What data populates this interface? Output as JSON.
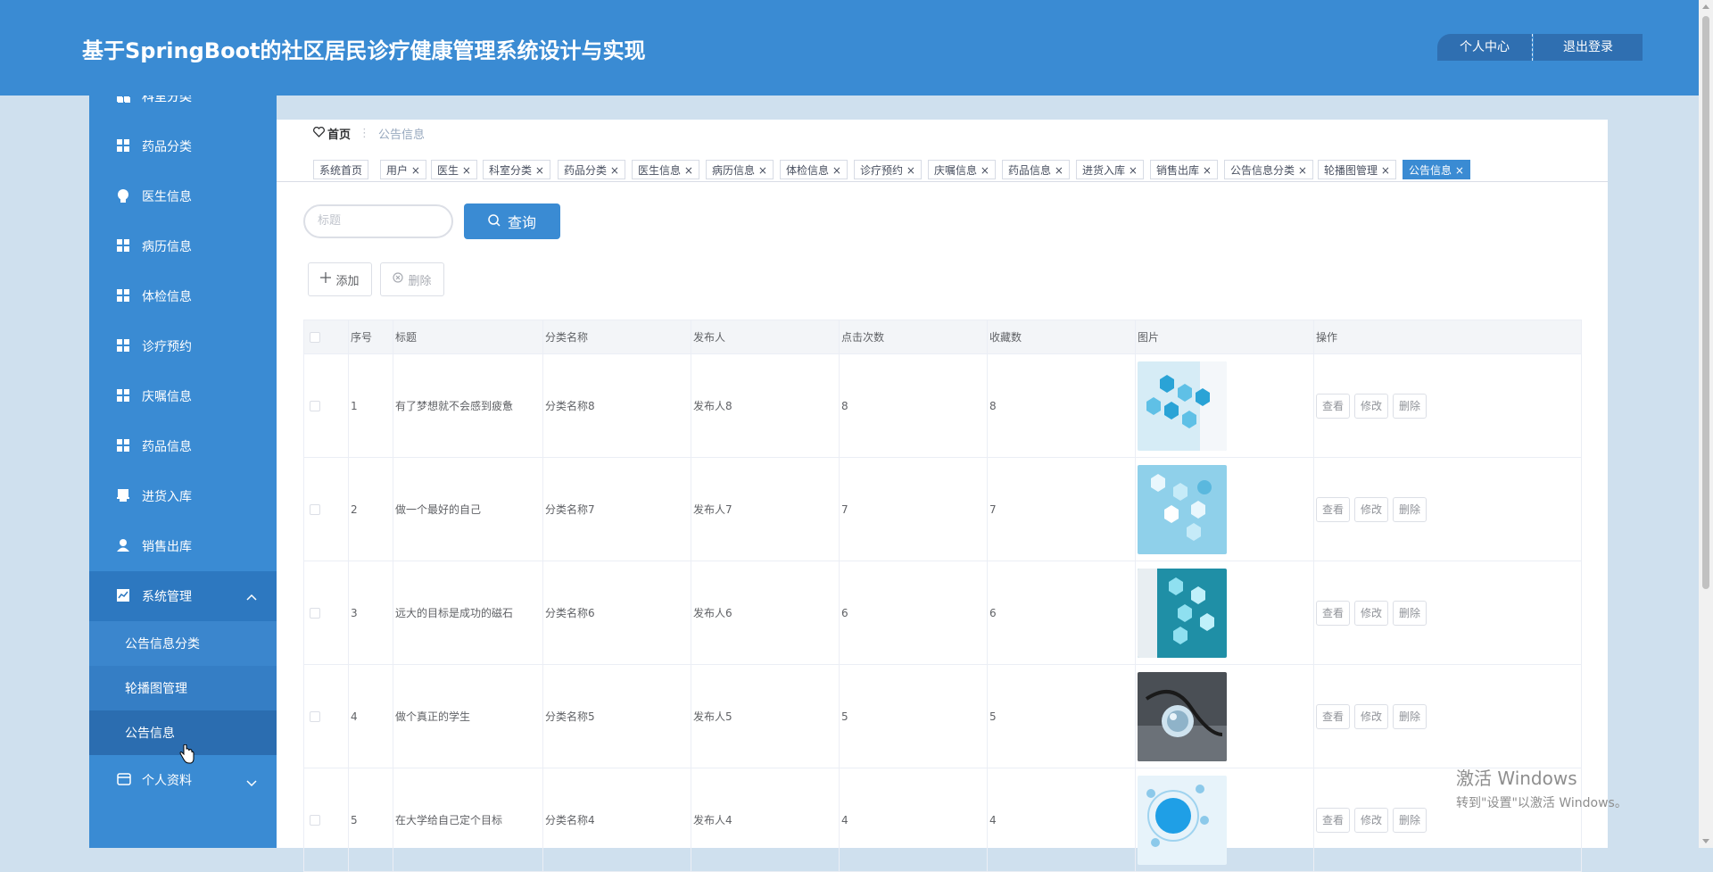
{
  "app": {
    "title": "基于SpringBoot的社区居民诊疗健康管理系统设计与实现",
    "user_center": "个人中心",
    "logout": "退出登录"
  },
  "sidebar": {
    "items": [
      {
        "label": "科室分类",
        "icon": "grid-icon"
      },
      {
        "label": "药品分类",
        "icon": "grid-icon"
      },
      {
        "label": "医生信息",
        "icon": "bulb-icon"
      },
      {
        "label": "病历信息",
        "icon": "grid-icon"
      },
      {
        "label": "体检信息",
        "icon": "grid-icon"
      },
      {
        "label": "诊疗预约",
        "icon": "grid-icon"
      },
      {
        "label": "庆嘱信息",
        "icon": "grid-icon"
      },
      {
        "label": "药品信息",
        "icon": "grid-icon"
      },
      {
        "label": "进货入库",
        "icon": "printer-icon"
      },
      {
        "label": "销售出库",
        "icon": "user-icon"
      },
      {
        "label": "系统管理",
        "icon": "chart-icon"
      },
      {
        "label": "个人资料",
        "icon": "card-icon"
      }
    ],
    "submenu": [
      {
        "label": "公告信息分类"
      },
      {
        "label": "轮播图管理"
      },
      {
        "label": "公告信息"
      }
    ]
  },
  "breadcrumb": {
    "home": "首页",
    "current": "公告信息"
  },
  "tags": [
    {
      "label": "系统首页"
    },
    {
      "label": "用户 ×"
    },
    {
      "label": "医生 ×"
    },
    {
      "label": "科室分类 ×"
    },
    {
      "label": "药品分类 ×"
    },
    {
      "label": "医生信息 ×"
    },
    {
      "label": "病历信息 ×"
    },
    {
      "label": "体检信息 ×"
    },
    {
      "label": "诊疗预约 ×"
    },
    {
      "label": "庆嘱信息 ×"
    },
    {
      "label": "药品信息 ×"
    },
    {
      "label": "进货入库 ×"
    },
    {
      "label": "销售出库 ×"
    },
    {
      "label": "公告信息分类 ×"
    },
    {
      "label": "轮播图管理 ×"
    },
    {
      "label": "公告信息 ×"
    }
  ],
  "search": {
    "placeholder": "标题",
    "button": "查询"
  },
  "actions": {
    "add": "添加",
    "delete": "删除"
  },
  "table": {
    "headers": [
      "序号",
      "标题",
      "分类名称",
      "发布人",
      "点击次数",
      "收藏数",
      "图片",
      "操作"
    ],
    "rows": [
      {
        "no": "1",
        "title": "有了梦想就不会感到疲惫",
        "category": "分类名称8",
        "publisher": "发布人8",
        "clicks": "8",
        "favorites": "8"
      },
      {
        "no": "2",
        "title": "做一个最好的自己",
        "category": "分类名称7",
        "publisher": "发布人7",
        "clicks": "7",
        "favorites": "7"
      },
      {
        "no": "3",
        "title": "远大的目标是成功的磁石",
        "category": "分类名称6",
        "publisher": "发布人6",
        "clicks": "6",
        "favorites": "6"
      },
      {
        "no": "4",
        "title": "做个真正的学生",
        "category": "分类名称5",
        "publisher": "发布人5",
        "clicks": "5",
        "favorites": "5"
      },
      {
        "no": "5",
        "title": "在大学给自己定个目标",
        "category": "分类名称4",
        "publisher": "发布人4",
        "clicks": "4",
        "favorites": "4"
      }
    ],
    "op_view": "查看",
    "op_edit": "修改",
    "op_delete": "删除"
  },
  "watermark": {
    "line1": "激活 Windows",
    "line2": "转到\"设置\"以激活 Windows。"
  },
  "colors": {
    "primary": "#3a8bd3",
    "header_button": "#2f6fb1"
  }
}
